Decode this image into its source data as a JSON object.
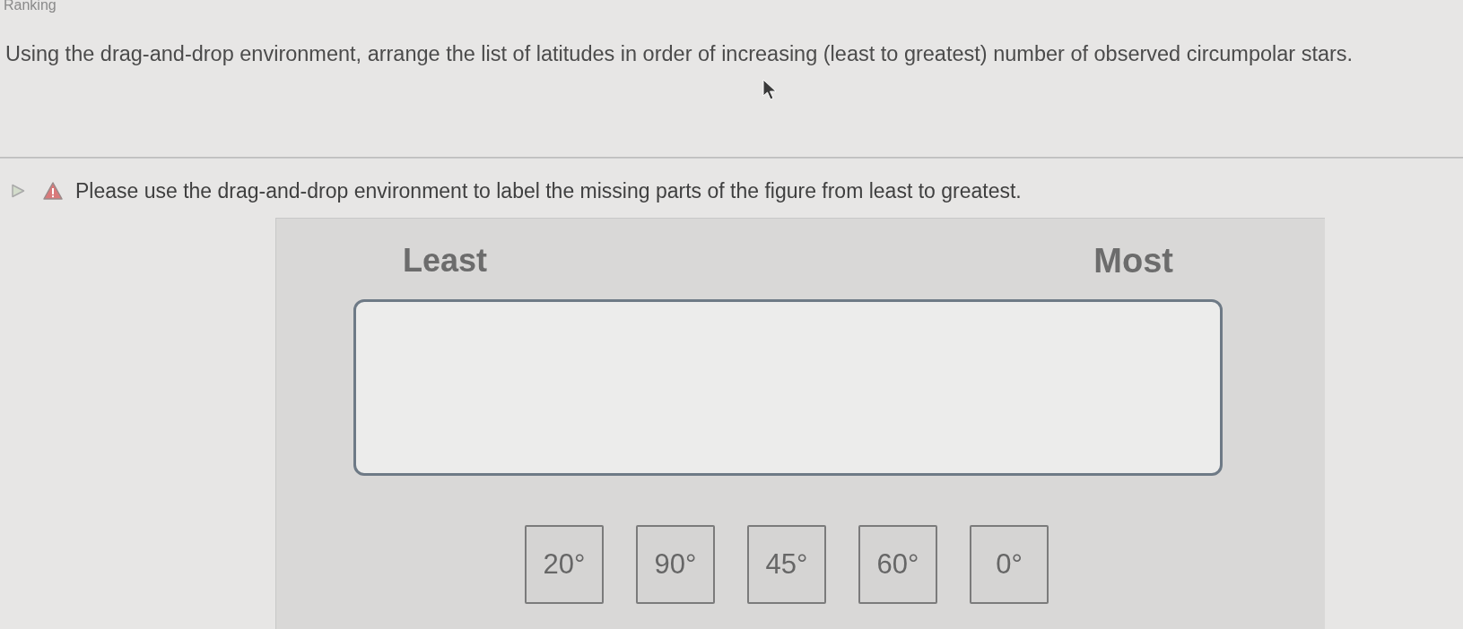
{
  "heading": "Ranking",
  "question": "Using the drag-and-drop environment, arrange the list of latitudes in order of increasing (least to greatest) number of observed circumpolar stars.",
  "hint": {
    "expanded": false,
    "text": "Please use the drag-and-drop environment to label the missing parts of the figure from least to greatest."
  },
  "ranking": {
    "least_label": "Least",
    "most_label": "Most",
    "tiles": [
      {
        "label": "20°"
      },
      {
        "label": "90°"
      },
      {
        "label": "45°"
      },
      {
        "label": "60°"
      },
      {
        "label": "0°"
      }
    ]
  }
}
